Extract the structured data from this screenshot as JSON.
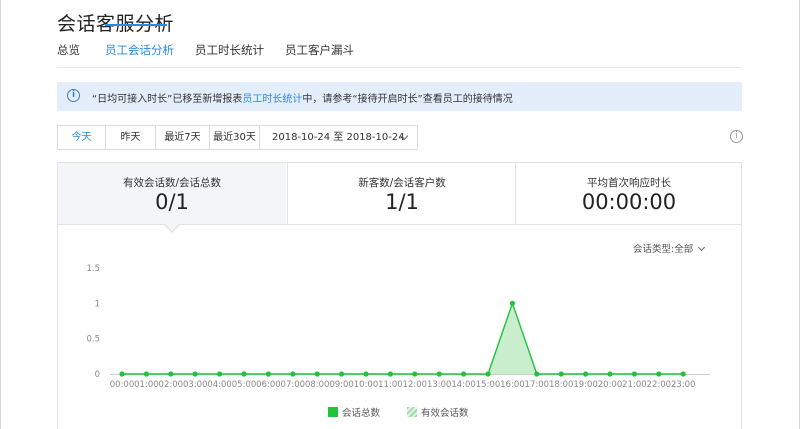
{
  "page_title": "会话客服分析",
  "tabs": [
    {
      "label": "总览",
      "active": false
    },
    {
      "label": "员工会话分析",
      "active": true
    },
    {
      "label": "员工时长统计",
      "active": false
    },
    {
      "label": "员工客户漏斗",
      "active": false
    }
  ],
  "notice": {
    "icon": "info-icon",
    "text_before": "“日均可接入时长”已移至新增报表",
    "link": "员工时长统计",
    "text_after": "中，请参考“接待开启时长”查看员工的接待情况"
  },
  "date_range": {
    "buttons": [
      "今天",
      "昨天",
      "最近7天",
      "最近30天"
    ],
    "active": "今天",
    "picker_value": "2018-10-24 至 2018-10-24"
  },
  "help_icon": "help-icon",
  "stats": [
    {
      "label": "有效会话数/会话总数",
      "value": "0/1"
    },
    {
      "label": "新客数/会话客户数",
      "value": "1/1"
    },
    {
      "label": "平均首次响应时长",
      "value": "00:00:00"
    }
  ],
  "filter": {
    "label": "会话类型:",
    "value": "全部"
  },
  "colors": {
    "accent": "#2b8ae2",
    "series_total": "#21c33b",
    "series_valid_fill": "#b8ecc0",
    "notice_bg": "#e3eefa"
  },
  "chart_data": {
    "type": "line",
    "x": [
      "00:00",
      "01:00",
      "02:00",
      "03:00",
      "04:00",
      "05:00",
      "06:00",
      "07:00",
      "08:00",
      "09:00",
      "10:00",
      "11:00",
      "12:00",
      "13:00",
      "14:00",
      "15:00",
      "16:00",
      "17:00",
      "18:00",
      "19:00",
      "20:00",
      "21:00",
      "22:00",
      "23:00"
    ],
    "yticks": [
      "0",
      "0.5",
      "1",
      "1.5"
    ],
    "ylim": [
      0,
      1.5
    ],
    "series": [
      {
        "name": "会话总数",
        "values": [
          0,
          0,
          0,
          0,
          0,
          0,
          0,
          0,
          0,
          0,
          0,
          0,
          0,
          0,
          0,
          0,
          1,
          0,
          0,
          0,
          0,
          0,
          0,
          0
        ],
        "style": "line"
      },
      {
        "name": "有效会话数",
        "values": [
          0,
          0,
          0,
          0,
          0,
          0,
          0,
          0,
          0,
          0,
          0,
          0,
          0,
          0,
          0,
          0,
          0,
          0,
          0,
          0,
          0,
          0,
          0,
          0
        ],
        "style": "area-hatched"
      }
    ],
    "grid": false,
    "legend": "bottom"
  }
}
